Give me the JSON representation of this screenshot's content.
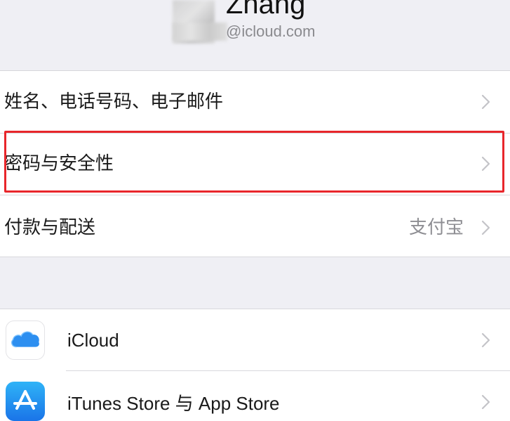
{
  "profile": {
    "name": "Zhang",
    "email_suffix": "@icloud.com"
  },
  "account_rows": [
    {
      "label": "姓名、电话号码、电子邮件",
      "value": ""
    },
    {
      "label": "密码与安全性",
      "value": ""
    },
    {
      "label": "付款与配送",
      "value": "支付宝"
    }
  ],
  "services": [
    {
      "label": "iCloud",
      "icon": "icloud-icon"
    },
    {
      "label": "iTunes Store 与 App Store",
      "icon": "app-store-icon"
    }
  ],
  "colors": {
    "highlight": "#e8262b",
    "background": "#efeff4",
    "chevron": "#c4c4c8"
  }
}
